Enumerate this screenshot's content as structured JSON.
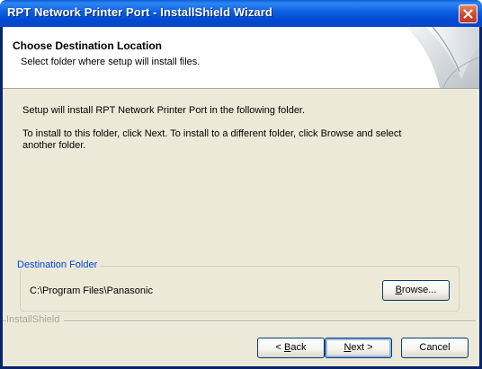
{
  "window": {
    "title": "RPT Network Printer Port - InstallShield Wizard"
  },
  "header": {
    "title": "Choose Destination Location",
    "subtitle": "Select folder where setup will install files."
  },
  "body": {
    "line1": "Setup will install RPT Network Printer Port in the following folder.",
    "line2a": "To install to this folder, click Next. To install to a different folder, click Browse and select",
    "line2b": "another folder."
  },
  "destination": {
    "group_label": "Destination Folder",
    "path": "C:\\Program Files\\Panasonic",
    "browse_label_u": "B",
    "browse_label_rest": "rowse..."
  },
  "footer": {
    "brand": "InstallShield",
    "back_u": "B",
    "back_rest": "ack",
    "next_u": "N",
    "next_rest": "ext >",
    "cancel_label": "Cancel"
  },
  "icons": [
    "close-icon",
    "header-art-icon"
  ],
  "colors": {
    "titlebar": "#0b5fe0",
    "client_bg": "#ece9d8",
    "group_label": "#0046d5",
    "close_button": "#d2452c"
  }
}
